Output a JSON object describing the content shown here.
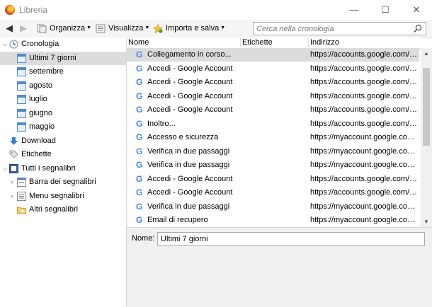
{
  "window": {
    "title": "Libreria",
    "controls": {
      "minimize": "—",
      "maximize": "☐",
      "close": "✕"
    }
  },
  "toolbar": {
    "back": "◀",
    "forward": "▶",
    "organize": "Organizza",
    "view": "Visualizza",
    "import_save": "Importa e salva",
    "dropdown_glyph": "▼"
  },
  "search": {
    "placeholder": "Cerca nella cronologia"
  },
  "sidebar": {
    "history": "Cronologia",
    "history_children": [
      "Ultimi 7 giorni",
      "settembre",
      "agosto",
      "luglio",
      "giugno",
      "maggio"
    ],
    "downloads": "Download",
    "tags": "Etichette",
    "all_bookmarks": "Tutti i segnalibri",
    "bookmarks_children": [
      "Barra dei segnalibri",
      "Menu segnalibri",
      "Altri segnalibri"
    ]
  },
  "table": {
    "columns": {
      "name": "Nome",
      "tags": "Etichette",
      "address": "Indirizzo"
    },
    "rows": [
      {
        "name": "Collegamento in corso...",
        "url": "https://accounts.google.com/o..."
      },
      {
        "name": "Accedi - Google Account",
        "url": "https://accounts.google.com/s..."
      },
      {
        "name": "Accedi - Google Account",
        "url": "https://accounts.google.com/s..."
      },
      {
        "name": "Accedi - Google Account",
        "url": "https://accounts.google.com/s..."
      },
      {
        "name": "Accedi - Google Account",
        "url": "https://accounts.google.com/s..."
      },
      {
        "name": "Inoltro...",
        "url": "https://accounts.google.com/o..."
      },
      {
        "name": "Accesso e sicurezza",
        "url": "https://myaccount.google.com..."
      },
      {
        "name": "Verifica in due passaggi",
        "url": "https://myaccount.google.com..."
      },
      {
        "name": "Verifica in due passaggi",
        "url": "https://myaccount.google.com..."
      },
      {
        "name": "Accedi - Google Account",
        "url": "https://accounts.google.com/s..."
      },
      {
        "name": "Accedi - Google Account",
        "url": "https://accounts.google.com/S..."
      },
      {
        "name": "Verifica in due passaggi",
        "url": "https://myaccount.google.com..."
      },
      {
        "name": "Email di recupero",
        "url": "https://myaccount.google.com..."
      }
    ]
  },
  "details": {
    "name_label": "Nome:",
    "name_value": "Ultimi 7 giorni"
  },
  "icons": {
    "search": "search-icon",
    "google": "G"
  },
  "colors": {
    "selection": "#dcdcdc",
    "google_blue": "#4285f4",
    "download_blue": "#2f7fd8"
  }
}
